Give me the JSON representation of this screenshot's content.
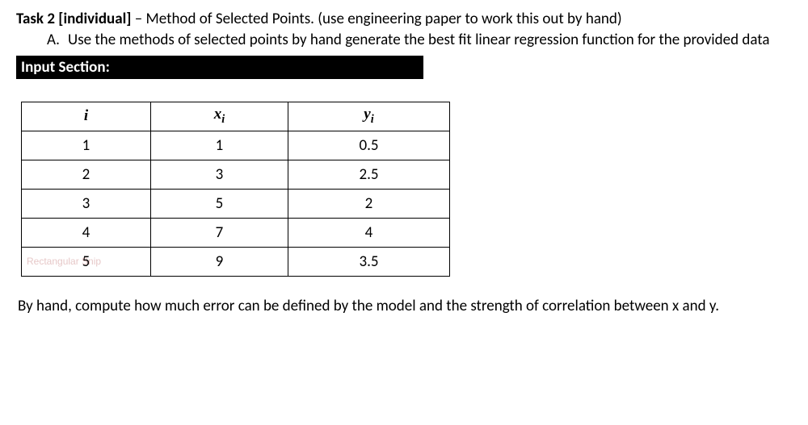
{
  "task": {
    "title_bold": "Task 2 [individual]",
    "title_rest": " – Method of Selected Points. (use engineering paper to work this out by hand)",
    "subitem_letter": "A.",
    "subitem_text": "Use the methods of selected points by hand generate the best fit linear regression function for the provided data"
  },
  "input_section_label": "Input Section:",
  "table": {
    "headers": {
      "i": "i",
      "x_base": "x",
      "x_sub": "i",
      "y_base": "y",
      "y_sub": "i"
    },
    "rows": [
      {
        "i": "1",
        "x": "1",
        "y": "0.5"
      },
      {
        "i": "2",
        "x": "3",
        "y": "2.5"
      },
      {
        "i": "3",
        "x": "5",
        "y": "2"
      },
      {
        "i": "4",
        "x": "7",
        "y": "4"
      },
      {
        "i": "5",
        "x": "9",
        "y": "3.5"
      }
    ],
    "watermark_text": "Rectangular Snip"
  },
  "footer": "By hand, compute how much error can be defined by the model and the strength of correlation between x and y.",
  "chart_data": {
    "type": "table",
    "columns": [
      "i",
      "x_i",
      "y_i"
    ],
    "data": [
      [
        1,
        1,
        0.5
      ],
      [
        2,
        3,
        2.5
      ],
      [
        3,
        5,
        2
      ],
      [
        4,
        7,
        4
      ],
      [
        5,
        9,
        3.5
      ]
    ]
  }
}
